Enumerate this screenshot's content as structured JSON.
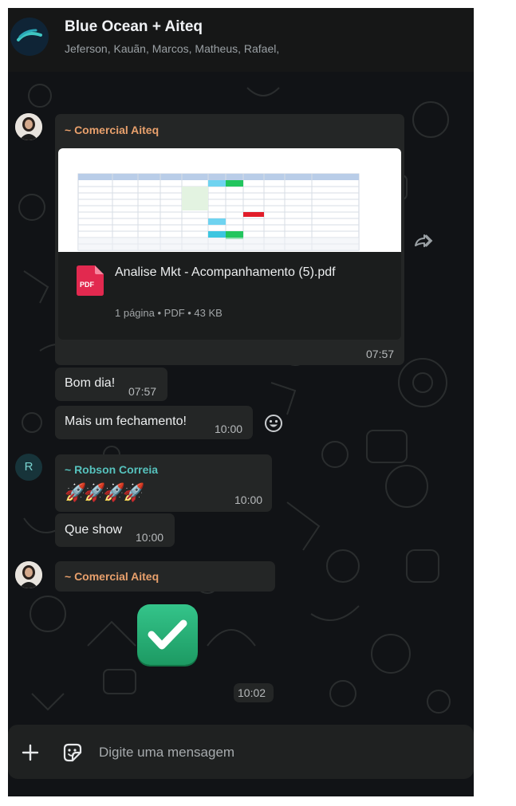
{
  "header": {
    "title": "Blue Ocean + Aiteq",
    "members": "Jeferson, Kauãn, Marcos, Matheus, Rafael,"
  },
  "messages": [
    {
      "sender": "~ Comercial Aiteq",
      "sender_color": "#e8a06c",
      "document": {
        "name": "Analise Mkt - Acompanhamento (5).pdf",
        "meta": "1 página • PDF • 43 KB",
        "type_badge": "PDF"
      },
      "time": "07:57"
    },
    {
      "text": "Bom dia!",
      "time": "07:57"
    },
    {
      "text": "Mais um fechamento!",
      "time": "10:00"
    },
    {
      "sender": "~ Robson Correia",
      "sender_color": "#56c2bd",
      "avatar_letter": "R",
      "text": "🚀🚀🚀🚀",
      "time": "10:00"
    },
    {
      "text": "Que show",
      "time": "10:00"
    },
    {
      "sender": "~ Comercial Aiteq",
      "sender_color": "#e8a06c",
      "sticker": "check-mark-sticker",
      "time": "10:02"
    }
  ],
  "composer": {
    "placeholder": "Digite uma mensagem"
  },
  "icons": {
    "attach": "plus-icon",
    "sticker": "sticker-icon",
    "forward": "forward-icon",
    "react": "emoji-icon"
  }
}
